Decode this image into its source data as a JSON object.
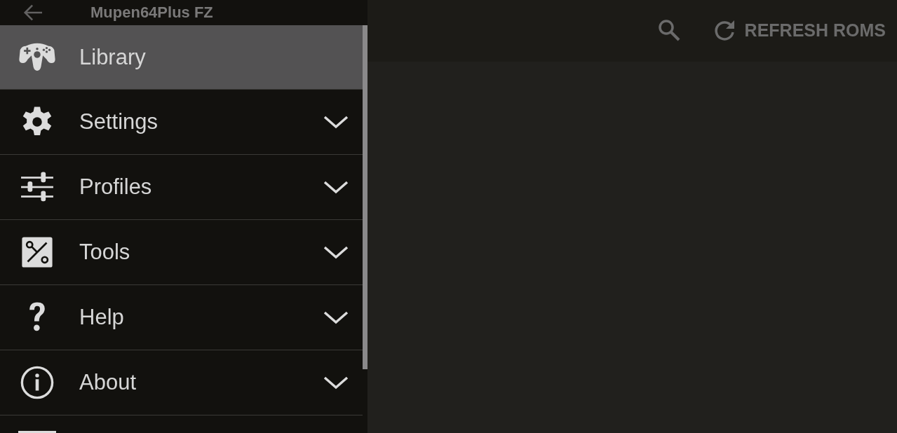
{
  "app_bar": {
    "title": "Mupen64Plus FZ",
    "actions": [
      {
        "kind": "search"
      },
      {
        "kind": "refresh",
        "label": "REFRESH ROMS"
      }
    ]
  },
  "drawer": {
    "items": [
      {
        "kind": "link",
        "label": "Library",
        "selected": true
      },
      {
        "kind": "group",
        "label": "Settings",
        "selected": false,
        "expanded": false
      },
      {
        "kind": "group",
        "label": "Profiles",
        "selected": false,
        "expanded": false
      },
      {
        "kind": "group",
        "label": "Tools",
        "selected": false,
        "expanded": false
      },
      {
        "kind": "group",
        "label": "Help",
        "selected": false,
        "expanded": false
      },
      {
        "kind": "group",
        "label": "About",
        "selected": false,
        "expanded": false
      }
    ]
  }
}
